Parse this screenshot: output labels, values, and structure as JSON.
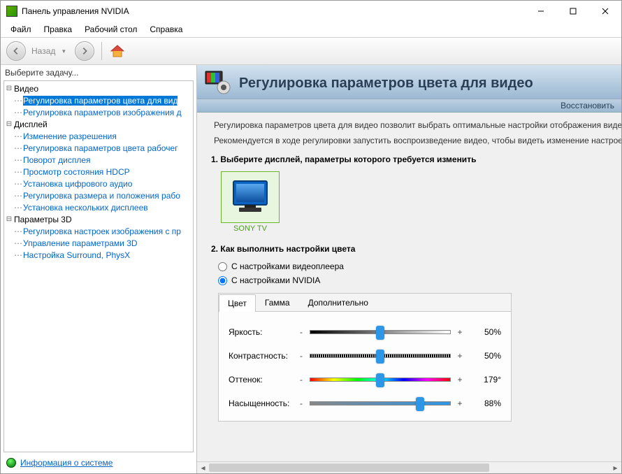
{
  "window": {
    "title": "Панель управления NVIDIA"
  },
  "menu": {
    "file": "Файл",
    "edit": "Правка",
    "desktop": "Рабочий стол",
    "help": "Справка"
  },
  "toolbar": {
    "back": "Назад"
  },
  "sidebar": {
    "prompt": "Выберите задачу...",
    "groups": [
      {
        "label": "Видео",
        "items": [
          "Регулировка параметров цвета для вид",
          "Регулировка параметров изображения д"
        ]
      },
      {
        "label": "Дисплей",
        "items": [
          "Изменение разрешения",
          "Регулировка параметров цвета рабочег",
          "Поворот дисплея",
          "Просмотр состояния HDCP",
          "Установка цифрового аудио",
          "Регулировка размера и положения рабо",
          "Установка нескольких дисплеев"
        ]
      },
      {
        "label": "Параметры 3D",
        "items": [
          "Регулировка настроек изображения с пр",
          "Управление параметрами 3D",
          "Настройка Surround, PhysX"
        ]
      }
    ],
    "selected": "Регулировка параметров цвета для вид",
    "sysinfo": "Информация о системе"
  },
  "page": {
    "title": "Регулировка параметров цвета для видео",
    "restore": "Восстановить",
    "desc1": "Регулировка параметров цвета для видео позволит выбрать оптимальные настройки отображения видео н",
    "desc2": "Рекомендуется в ходе регулировки запустить воспроизведение видео, чтобы видеть изменение настроек в",
    "step1": "1. Выберите дисплей, параметры которого требуется изменить",
    "display": "SONY TV",
    "step2": "2. Как выполнить настройки цвета",
    "radio_player": "С настройками видеоплеера",
    "radio_nvidia": "С настройками NVIDIA",
    "tabs": {
      "color": "Цвет",
      "gamma": "Гамма",
      "extra": "Дополнительно"
    },
    "sliders": {
      "brightness": {
        "label": "Яркость:",
        "value": "50%",
        "pos": 50
      },
      "contrast": {
        "label": "Контрастность:",
        "value": "50%",
        "pos": 50
      },
      "hue": {
        "label": "Оттенок:",
        "value": "179°",
        "pos": 50
      },
      "saturation": {
        "label": "Насыщенность:",
        "value": "88%",
        "pos": 78
      }
    }
  }
}
